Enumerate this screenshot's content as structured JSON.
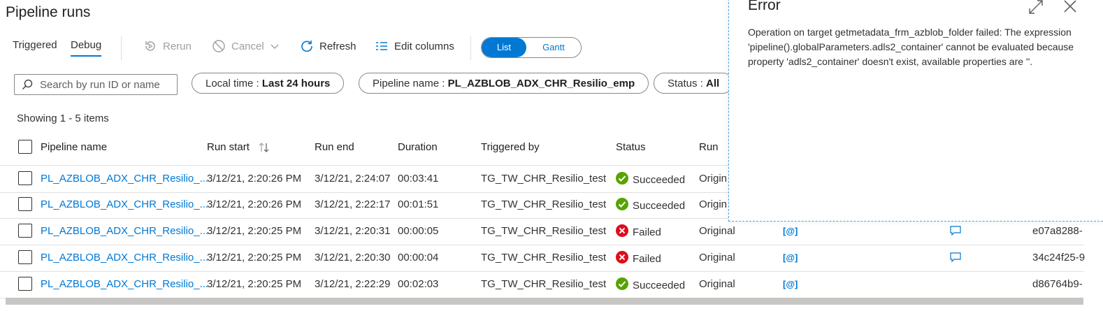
{
  "page": {
    "title": "Pipeline runs"
  },
  "toolbar": {
    "tabs": [
      {
        "label": "Triggered",
        "active": false
      },
      {
        "label": "Debug",
        "active": true
      }
    ],
    "rerun": "Rerun",
    "cancel": "Cancel",
    "refresh": "Refresh",
    "edit_columns": "Edit columns",
    "view_toggle": {
      "list": "List",
      "gantt": "Gantt",
      "selected": "List"
    }
  },
  "filters": {
    "search_placeholder": "Search by run ID or name",
    "local_time": {
      "label": "Local time : ",
      "value": "Last 24 hours"
    },
    "pipeline_name": {
      "label": "Pipeline name : ",
      "value": "PL_AZBLOB_ADX_CHR_Resilio_emp"
    },
    "status": {
      "label": "Status : ",
      "value": "All"
    }
  },
  "table": {
    "showing": "Showing 1 - 5 items",
    "columns": {
      "pipeline_name": "Pipeline name",
      "run_start": "Run start",
      "run_end": "Run end",
      "duration": "Duration",
      "triggered_by": "Triggered by",
      "status": "Status",
      "run": "Run"
    },
    "rows": [
      {
        "pipeline": "PL_AZBLOB_ADX_CHR_Resilio_...",
        "start": "3/12/21, 2:20:26 PM",
        "end": "3/12/21, 2:24:07",
        "duration": "00:03:41",
        "triggered_by": "TG_TW_CHR_Resilio_test",
        "status": "Succeeded",
        "run": "Origin",
        "params": "",
        "annotations": "",
        "run_id": ""
      },
      {
        "pipeline": "PL_AZBLOB_ADX_CHR_Resilio_...",
        "start": "3/12/21, 2:20:26 PM",
        "end": "3/12/21, 2:22:17",
        "duration": "00:01:51",
        "triggered_by": "TG_TW_CHR_Resilio_test",
        "status": "Succeeded",
        "run": "Origin",
        "params": "",
        "annotations": "",
        "run_id": ""
      },
      {
        "pipeline": "PL_AZBLOB_ADX_CHR_Resilio_...",
        "start": "3/12/21, 2:20:25 PM",
        "end": "3/12/21, 2:20:31",
        "duration": "00:00:05",
        "triggered_by": "TG_TW_CHR_Resilio_test",
        "status": "Failed",
        "run": "Original",
        "params": "[@]",
        "annotations": "comment",
        "run_id": "e07a8288-"
      },
      {
        "pipeline": "PL_AZBLOB_ADX_CHR_Resilio_...",
        "start": "3/12/21, 2:20:25 PM",
        "end": "3/12/21, 2:20:30",
        "duration": "00:00:04",
        "triggered_by": "TG_TW_CHR_Resilio_test",
        "status": "Failed",
        "run": "Original",
        "params": "[@]",
        "annotations": "comment",
        "run_id": "34c24f25-9"
      },
      {
        "pipeline": "PL_AZBLOB_ADX_CHR_Resilio_...",
        "start": "3/12/21, 2:20:25 PM",
        "end": "3/12/21, 2:22:29",
        "duration": "00:02:03",
        "triggered_by": "TG_TW_CHR_Resilio_test",
        "status": "Succeeded",
        "run": "Original",
        "params": "[@]",
        "annotations": "",
        "run_id": "d86764b9-"
      }
    ]
  },
  "error_panel": {
    "title": "Error",
    "message": "Operation on target getmetadata_frm_azblob_folder failed: The expression 'pipeline().globalParameters.adls2_container' cannot be evaluated because property 'adls2_container' doesn't exist, available properties are ''."
  },
  "colors": {
    "accent": "#0078d4",
    "success": "#57a300",
    "failure": "#e00b1c"
  }
}
